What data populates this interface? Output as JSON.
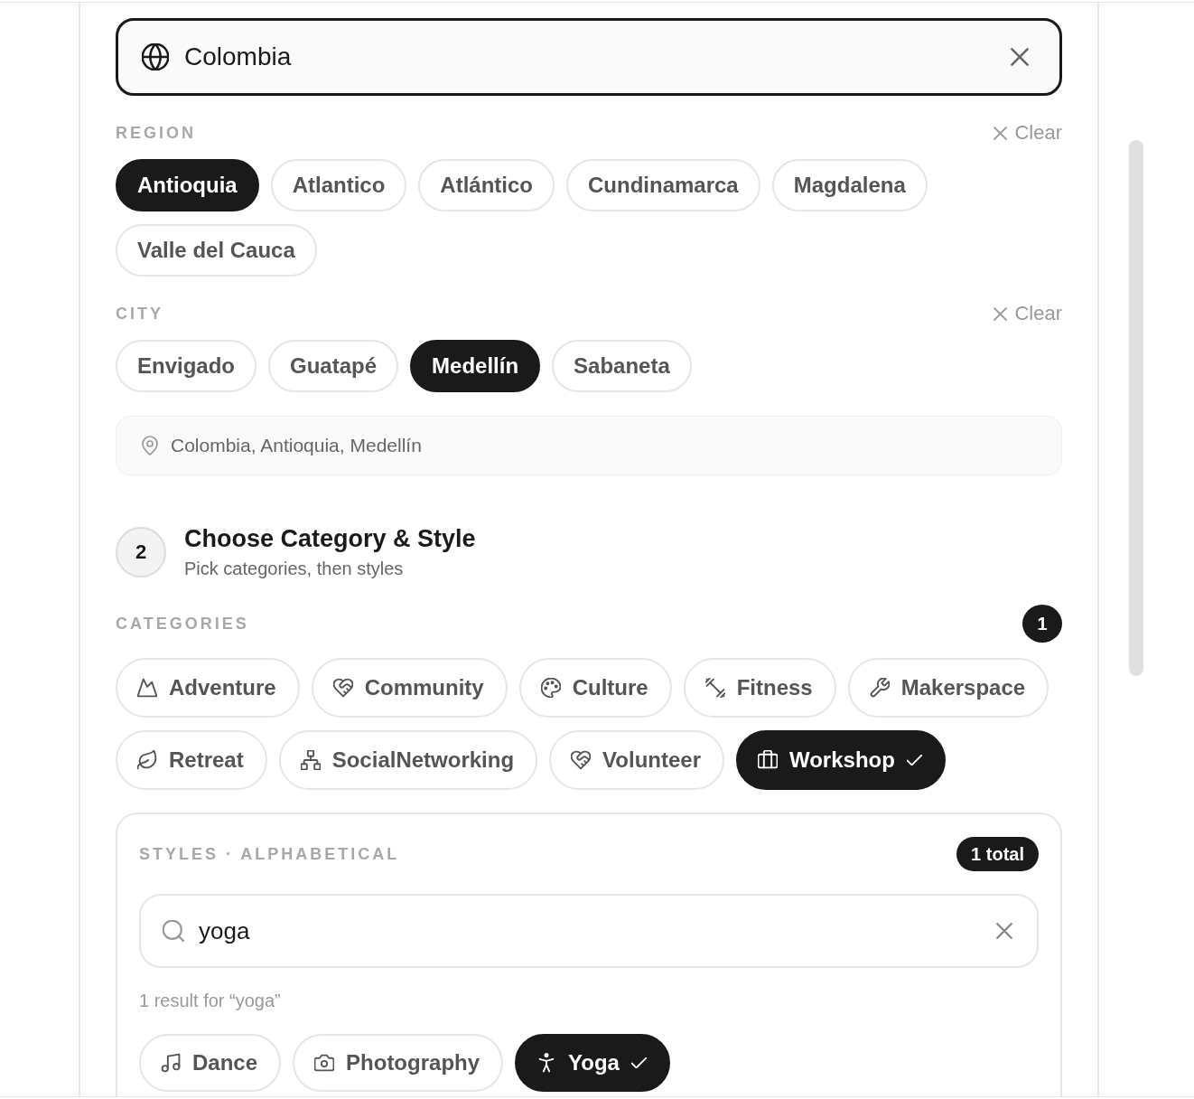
{
  "country_field": {
    "value": "Colombia"
  },
  "region": {
    "label": "REGION",
    "clear_label": "Clear",
    "options": [
      {
        "label": "Antioquia",
        "selected": true
      },
      {
        "label": "Atlantico",
        "selected": false
      },
      {
        "label": "Atlántico",
        "selected": false
      },
      {
        "label": "Cundinamarca",
        "selected": false
      },
      {
        "label": "Magdalena",
        "selected": false
      },
      {
        "label": "Valle del Cauca",
        "selected": false
      }
    ]
  },
  "city": {
    "label": "CITY",
    "clear_label": "Clear",
    "options": [
      {
        "label": "Envigado",
        "selected": false
      },
      {
        "label": "Guatapé",
        "selected": false
      },
      {
        "label": "Medellín",
        "selected": true
      },
      {
        "label": "Sabaneta",
        "selected": false
      }
    ]
  },
  "location_summary": "Colombia, Antioquia, Medellín",
  "step": {
    "number": "2",
    "title": "Choose Category & Style",
    "subtitle": "Pick categories, then styles"
  },
  "categories": {
    "label": "CATEGORIES",
    "count": "1",
    "options": [
      {
        "label": "Adventure",
        "kind": "mountain",
        "selected": false
      },
      {
        "label": "Community",
        "kind": "handshake",
        "selected": false
      },
      {
        "label": "Culture",
        "kind": "palette",
        "selected": false
      },
      {
        "label": "Fitness",
        "kind": "dumbbell",
        "selected": false
      },
      {
        "label": "Makerspace",
        "kind": "wrench",
        "selected": false
      },
      {
        "label": "Retreat",
        "kind": "leaf",
        "selected": false
      },
      {
        "label": "SocialNetworking",
        "kind": "network",
        "selected": false
      },
      {
        "label": "Volunteer",
        "kind": "handshake",
        "selected": false
      },
      {
        "label": "Workshop",
        "kind": "briefcase",
        "selected": true
      }
    ]
  },
  "styles": {
    "label": "STYLES · ALPHABETICAL",
    "count": "1 total",
    "search": {
      "value": "yoga"
    },
    "result_text": "1 result for “yoga”",
    "options": [
      {
        "label": "Dance",
        "kind": "music",
        "selected": false
      },
      {
        "label": "Photography",
        "kind": "camera",
        "selected": false
      },
      {
        "label": "Yoga",
        "kind": "person",
        "selected": true
      }
    ]
  }
}
